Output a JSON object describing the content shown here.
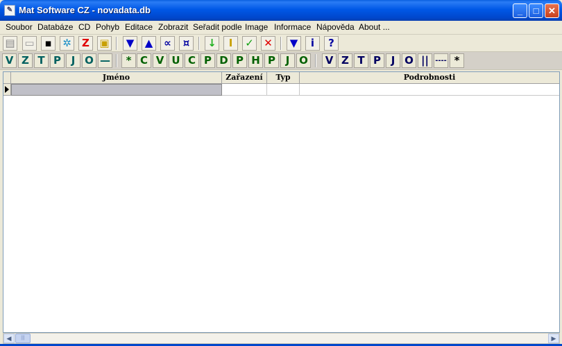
{
  "window": {
    "title": "Mat Software CZ - novadata.db",
    "icon_glyph": "✎",
    "minimize_glyph": "_",
    "maximize_glyph": "□",
    "close_glyph": "✕"
  },
  "menu": [
    "Soubor",
    "Databáze",
    "CD",
    "Pohyb",
    "Editace",
    "Zobrazit",
    "Seřadit podle",
    "Image",
    "Informace",
    "Nápověda",
    "About ..."
  ],
  "toolbar1": [
    {
      "icon": "new-icon",
      "glyph": "▤",
      "color": "#888888"
    },
    {
      "icon": "open-icon",
      "glyph": "▭",
      "color": "#999999"
    },
    {
      "icon": "save-icon",
      "glyph": "▪",
      "color": "#000000"
    },
    {
      "icon": "settings-icon",
      "glyph": "✲",
      "color": "#1e90c8"
    },
    {
      "icon": "z-icon",
      "glyph": "Z",
      "color": "#e00000"
    },
    {
      "icon": "print-icon",
      "glyph": "▣",
      "color": "#c8a000"
    },
    {
      "icon": "move-down-icon",
      "glyph": "▼",
      "color": "#0000c8"
    },
    {
      "icon": "move-up-icon",
      "glyph": "▲",
      "color": "#0000c8"
    },
    {
      "icon": "first-icon",
      "glyph": "∝",
      "color": "#0000a0"
    },
    {
      "icon": "last-icon",
      "glyph": "¤",
      "color": "#0000a0"
    },
    {
      "icon": "insert-icon",
      "glyph": "↓",
      "color": "#20b020"
    },
    {
      "icon": "edit-icon",
      "glyph": "I",
      "color": "#c8a000"
    },
    {
      "icon": "confirm-icon",
      "glyph": "✓",
      "color": "#10a010"
    },
    {
      "icon": "cancel-icon",
      "glyph": "✕",
      "color": "#e00000"
    },
    {
      "icon": "bookmark-icon",
      "glyph": "▼",
      "color": "#0000c8"
    },
    {
      "icon": "info-icon",
      "glyph": "i",
      "color": "#0000a0"
    },
    {
      "icon": "help-icon",
      "glyph": "?",
      "color": "#0000a0"
    }
  ],
  "toolbar2_left": [
    {
      "icon": "filter-v-icon",
      "glyph": "V",
      "color": "#006060"
    },
    {
      "icon": "filter-z-icon",
      "glyph": "Z",
      "color": "#006060"
    },
    {
      "icon": "filter-t-icon",
      "glyph": "T",
      "color": "#006060"
    },
    {
      "icon": "filter-p-icon",
      "glyph": "P",
      "color": "#006060"
    },
    {
      "icon": "filter-j-icon",
      "glyph": "J",
      "color": "#006060"
    },
    {
      "icon": "filter-o-icon",
      "glyph": "O",
      "color": "#006060"
    },
    {
      "icon": "filter-dash-icon",
      "glyph": "—",
      "color": "#006060"
    }
  ],
  "toolbar2_mid": [
    {
      "icon": "filter-all-icon",
      "glyph": "*",
      "color": "#006000"
    },
    {
      "icon": "filter-c-icon",
      "glyph": "C",
      "color": "#006000"
    },
    {
      "icon": "filter-v2-icon",
      "glyph": "V",
      "color": "#006000"
    },
    {
      "icon": "filter-u-icon",
      "glyph": "U",
      "color": "#006000"
    },
    {
      "icon": "filter-c2-icon",
      "glyph": "C",
      "color": "#006000"
    },
    {
      "icon": "filter-p2-icon",
      "glyph": "P",
      "color": "#006000"
    },
    {
      "icon": "filter-d-icon",
      "glyph": "D",
      "color": "#006000"
    },
    {
      "icon": "filter-p3-icon",
      "glyph": "P",
      "color": "#006000"
    },
    {
      "icon": "filter-h-icon",
      "glyph": "H",
      "color": "#006000"
    },
    {
      "icon": "filter-p4-icon",
      "glyph": "P",
      "color": "#006000"
    },
    {
      "icon": "filter-j2-icon",
      "glyph": "J",
      "color": "#006000"
    },
    {
      "icon": "filter-o2-icon",
      "glyph": "O",
      "color": "#006000"
    }
  ],
  "toolbar2_right": [
    {
      "icon": "filter-v3-icon",
      "glyph": "V",
      "color": "#000060"
    },
    {
      "icon": "filter-z3-icon",
      "glyph": "Z",
      "color": "#000060"
    },
    {
      "icon": "filter-t3-icon",
      "glyph": "T",
      "color": "#000060"
    },
    {
      "icon": "filter-p5-icon",
      "glyph": "P",
      "color": "#000060"
    },
    {
      "icon": "filter-j3-icon",
      "glyph": "J",
      "color": "#000060"
    },
    {
      "icon": "filter-o3-icon",
      "glyph": "O",
      "color": "#000060"
    },
    {
      "icon": "filter-bars-icon",
      "glyph": "||",
      "color": "#000060"
    },
    {
      "icon": "filter-dots-icon",
      "glyph": "----",
      "color": "#000060"
    },
    {
      "icon": "filter-all2-icon",
      "glyph": "*",
      "color": "#000000"
    }
  ],
  "grid": {
    "columns": [
      "Jméno",
      "Zařazení",
      "Typ",
      "Podrobnosti"
    ],
    "selected_row_color": "#c0c0c8"
  },
  "scrollbar": {
    "left_glyph": "◀",
    "right_glyph": "▶",
    "thumb_glyph": "|||"
  }
}
